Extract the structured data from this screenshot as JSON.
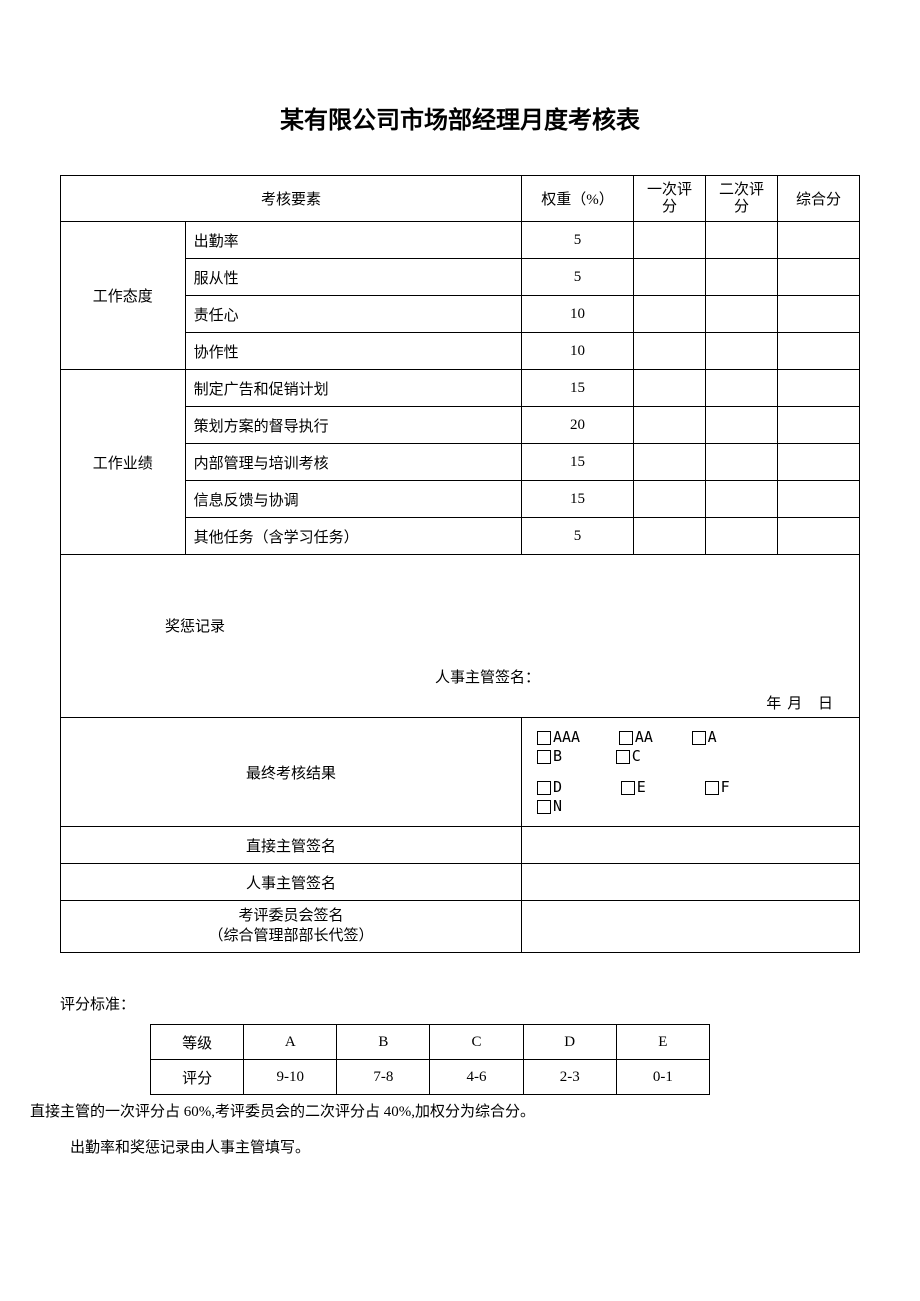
{
  "title": "某有限公司市场部经理月度考核表",
  "header": {
    "element": "考核要素",
    "weight": "权重（%）",
    "score1": "一次评分",
    "score2": "二次评  分",
    "score3": "综合分"
  },
  "group1_label": "工作态度",
  "group1_items": [
    {
      "name": "出勤率",
      "weight": "5"
    },
    {
      "name": "服从性",
      "weight": "5"
    },
    {
      "name": "责任心",
      "weight": "10"
    },
    {
      "name": "协作性",
      "weight": "10"
    }
  ],
  "group2_label": "工作业绩",
  "group2_items": [
    {
      "name": "制定广告和促销计划",
      "weight": "15"
    },
    {
      "name": "策划方案的督导执行",
      "weight": "20"
    },
    {
      "name": "内部管理与培训考核",
      "weight": "15"
    },
    {
      "name": "信息反馈与协调",
      "weight": "15"
    },
    {
      "name": "其他任务（含学习任务）",
      "weight": "5"
    }
  ],
  "reward": {
    "label": "奖惩记录",
    "sign": "人事主管签名：",
    "date": "年月    日"
  },
  "final": {
    "label": "最终考核结果",
    "options_row1": [
      "AAA",
      "AA",
      "A",
      "B",
      "C"
    ],
    "options_row2": [
      "D",
      "E",
      "F",
      "N"
    ]
  },
  "signatures": {
    "direct": "直接主管签名",
    "hr": "人事主管签名",
    "committee": "考评委员会签名",
    "committee_sub": "（综合管理部部长代签）"
  },
  "criteria": {
    "title": "评分标准：",
    "grade_label": "等级",
    "score_label": "评分",
    "grades": [
      "A",
      "B",
      "C",
      "D",
      "E"
    ],
    "scores": [
      "9-10",
      "7-8",
      "4-6",
      "2-3",
      "0-1"
    ]
  },
  "note1": "直接主管的一次评分占 60%,考评委员会的二次评分占 40%,加权分为综合分。",
  "note2": "出勤率和奖惩记录由人事主管填写。"
}
